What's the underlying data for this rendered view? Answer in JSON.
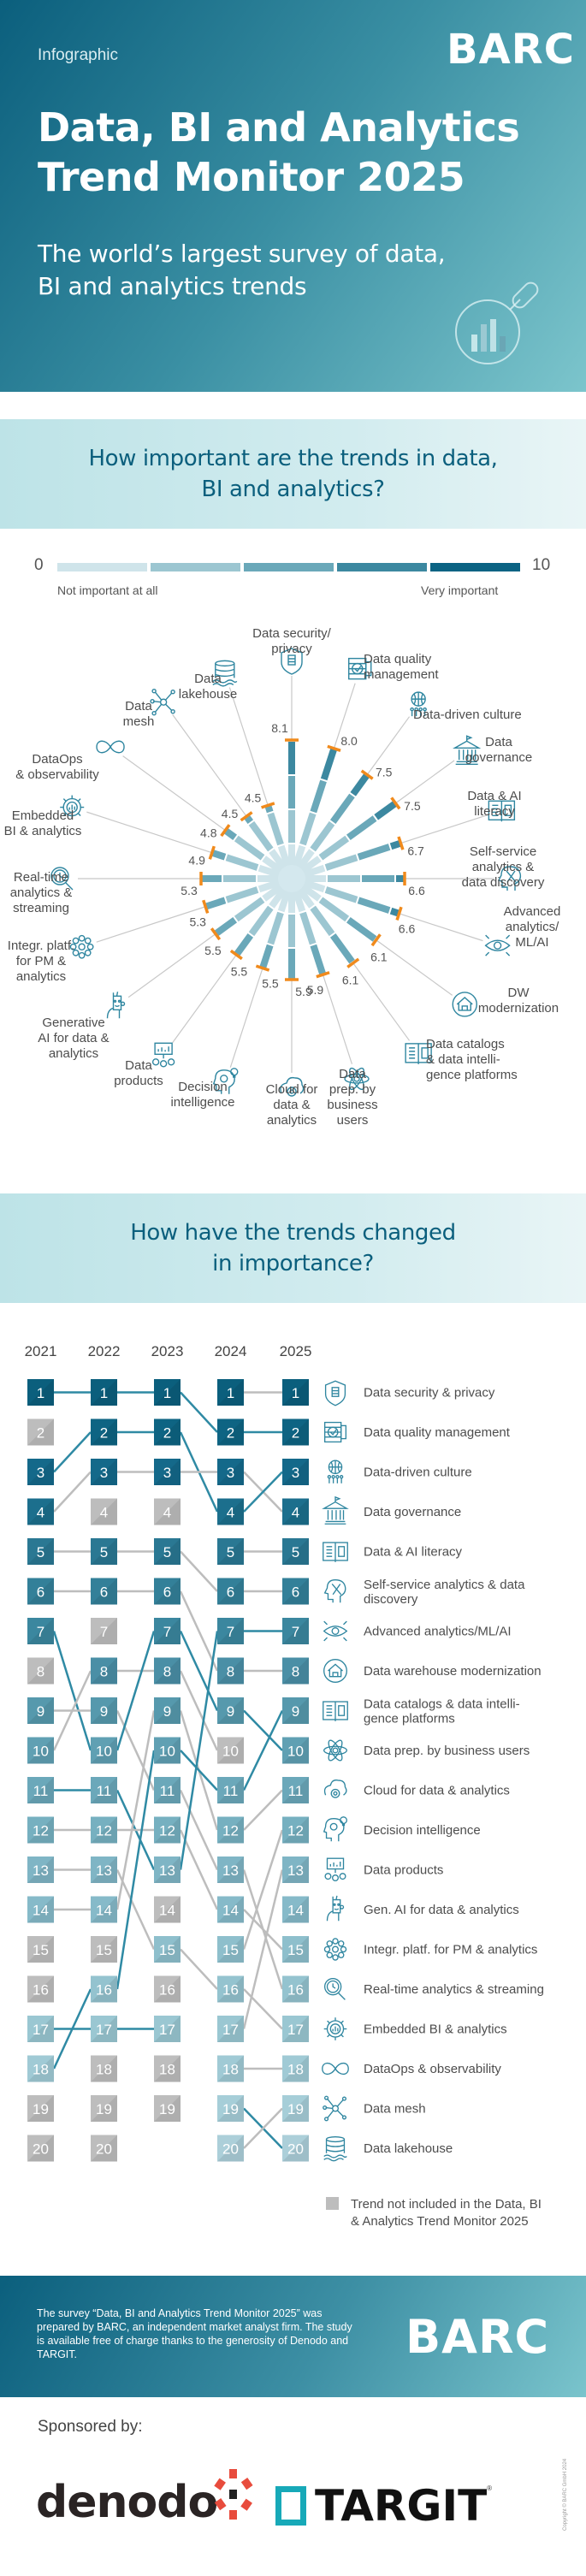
{
  "hero": {
    "kicker": "Infographic",
    "logo": "BARC",
    "title_line1": "Data, BI and Analytics",
    "title_line2": "Trend Monitor 2025",
    "subtitle_line1": "The world’s largest survey of data,",
    "subtitle_line2": "BI and analytics trends",
    "icon": "magnifier-chart-icon"
  },
  "section1": {
    "title_line1": "How important are the trends in data,",
    "title_line2": "BI and analytics?",
    "scale": {
      "min": "0",
      "max": "10",
      "min_label": "Not important at all",
      "max_label": "Very important",
      "colors": [
        "#cfe4ea",
        "#9cc6d1",
        "#6aa8b9",
        "#3c88a0",
        "#0b6383"
      ]
    }
  },
  "section2": {
    "title_line1": "How have the trends changed",
    "title_line2": "in importance?",
    "legend_note_line1": "Trend not included in the Data, BI",
    "legend_note_line2": "& Analytics Trend Monitor 2025"
  },
  "colors": {
    "brand_dark": "#0b5f7d",
    "accent_orange": "#f08a1c",
    "not_included_gray": "#bdbdbd",
    "line_blue": "#2f8aa4",
    "line_gray": "#bdbdbd"
  },
  "chart_data": [
    {
      "type": "radial-bar",
      "title": "How important are the trends in data, BI and analytics?",
      "scale_range": [
        0,
        10
      ],
      "categories": [
        {
          "label": "Data security/ privacy",
          "lines": [
            "Data security/",
            "privacy"
          ],
          "value": 8.1,
          "icon": "shield-database-icon"
        },
        {
          "label": "Data quality management",
          "lines": [
            "Data quality",
            "management"
          ],
          "value": 8.0,
          "icon": "database-check-icon"
        },
        {
          "label": "Data-driven culture",
          "lines": [
            "Data-driven culture"
          ],
          "value": 7.5,
          "icon": "globe-people-icon"
        },
        {
          "label": "Data governance",
          "lines": [
            "Data",
            "governance"
          ],
          "value": 7.5,
          "icon": "institution-icon"
        },
        {
          "label": "Data & AI literacy",
          "lines": [
            "Data & AI",
            "literacy"
          ],
          "value": 6.7,
          "icon": "book-database-icon"
        },
        {
          "label": "Self-service analytics & data discovery",
          "lines": [
            "Self-service",
            "analytics &",
            "data discovery"
          ],
          "value": 6.6,
          "icon": "head-tools-icon"
        },
        {
          "label": "Advanced analytics/ ML/AI",
          "lines": [
            "Advanced",
            "analytics/",
            "ML/AI"
          ],
          "value": 6.6,
          "icon": "eye-wrench-icon"
        },
        {
          "label": "DW modernization",
          "lines": [
            "DW",
            "modernization"
          ],
          "value": 6.1,
          "icon": "warehouse-cycle-icon"
        },
        {
          "label": "Data catalogs & data intelligence platforms",
          "lines": [
            "Data catalogs",
            "& data intelli-",
            "gence platforms"
          ],
          "value": 6.1,
          "icon": "book-open-icon"
        },
        {
          "label": "Data prep. by business users",
          "lines": [
            "Data",
            "prep. by",
            "business",
            "users"
          ],
          "value": 5.9,
          "icon": "atom-icon"
        },
        {
          "label": "Cloud for data & analytics",
          "lines": [
            "Cloud for",
            "data &",
            "analytics"
          ],
          "value": 5.9,
          "icon": "cloud-gear-icon"
        },
        {
          "label": "Decision intelligence",
          "lines": [
            "Decision",
            "intelligence"
          ],
          "value": 5.5,
          "icon": "head-gear-bulb-icon"
        },
        {
          "label": "Data products",
          "lines": [
            "Data",
            "products"
          ],
          "value": 5.5,
          "icon": "monitor-cubes-icon"
        },
        {
          "label": "Generative AI for data & analytics",
          "lines": [
            "Generative",
            "AI for data &",
            "analytics"
          ],
          "value": 5.5,
          "icon": "robot-face-icon"
        },
        {
          "label": "Integr. platf. for PM & analytics",
          "lines": [
            "Integr. platf.",
            "for PM &",
            "analytics"
          ],
          "value": 5.3,
          "icon": "hub-nodes-icon"
        },
        {
          "label": "Real-time analytics & streaming",
          "lines": [
            "Real-time",
            "analytics &",
            "streaming"
          ],
          "value": 5.3,
          "icon": "magnifier-clock-icon"
        },
        {
          "label": "Embedded BI & analytics",
          "lines": [
            "Embedded",
            "BI & analytics"
          ],
          "value": 4.9,
          "icon": "gear-chart-icon"
        },
        {
          "label": "DataOps & observability",
          "lines": [
            "DataOps",
            "& observability"
          ],
          "value": 4.8,
          "icon": "infinity-icon"
        },
        {
          "label": "Data mesh",
          "lines": [
            "Data",
            "mesh"
          ],
          "value": 4.5,
          "icon": "mesh-nodes-icon"
        },
        {
          "label": "Data lakehouse",
          "lines": [
            "Data",
            "lakehouse"
          ],
          "value": 4.5,
          "icon": "lakehouse-icon"
        }
      ]
    },
    {
      "type": "rank-slope",
      "title": "How have the trends changed in importance?",
      "years": [
        "2021",
        "2022",
        "2023",
        "2024",
        "2025"
      ],
      "ranks": [
        "1",
        "2",
        "3",
        "4",
        "5",
        "6",
        "7",
        "8",
        "9",
        "10",
        "11",
        "12",
        "13",
        "14",
        "15",
        "16",
        "17",
        "18",
        "19",
        "20"
      ],
      "max_rank_per_year": [
        20,
        20,
        19,
        20,
        20
      ],
      "not_included": {
        "2021": [
          2,
          8,
          15,
          16,
          19,
          20
        ],
        "2022": [
          4,
          7,
          15,
          18,
          19,
          20
        ],
        "2023": [
          4,
          14,
          16,
          18,
          19
        ],
        "2024": [
          10
        ],
        "2025": []
      },
      "links": [
        {
          "from_year": 0,
          "from": 1,
          "to": 1,
          "color": "blue"
        },
        {
          "from_year": 0,
          "from": 3,
          "to": 2,
          "color": "blue"
        },
        {
          "from_year": 0,
          "from": 4,
          "to": 3,
          "color": "gray"
        },
        {
          "from_year": 0,
          "from": 5,
          "to": 5,
          "color": "gray"
        },
        {
          "from_year": 0,
          "from": 6,
          "to": 6,
          "color": "gray"
        },
        {
          "from_year": 0,
          "from": 7,
          "to": 10,
          "color": "blue"
        },
        {
          "from_year": 0,
          "from": 9,
          "to": 9,
          "color": "gray"
        },
        {
          "from_year": 0,
          "from": 10,
          "to": 8,
          "color": "gray"
        },
        {
          "from_year": 0,
          "from": 11,
          "to": 11,
          "color": "blue"
        },
        {
          "from_year": 0,
          "from": 12,
          "to": 12,
          "color": "gray"
        },
        {
          "from_year": 0,
          "from": 13,
          "to": 13,
          "color": "gray"
        },
        {
          "from_year": 0,
          "from": 14,
          "to": 14,
          "color": "gray"
        },
        {
          "from_year": 0,
          "from": 17,
          "to": 17,
          "color": "blue"
        },
        {
          "from_year": 0,
          "from": 18,
          "to": 16,
          "color": "blue"
        },
        {
          "from_year": 1,
          "from": 1,
          "to": 1,
          "color": "blue"
        },
        {
          "from_year": 1,
          "from": 2,
          "to": 2,
          "color": "blue"
        },
        {
          "from_year": 1,
          "from": 3,
          "to": 3,
          "color": "gray"
        },
        {
          "from_year": 1,
          "from": 5,
          "to": 5,
          "color": "gray"
        },
        {
          "from_year": 1,
          "from": 6,
          "to": 6,
          "color": "gray"
        },
        {
          "from_year": 1,
          "from": 8,
          "to": 8,
          "color": "gray"
        },
        {
          "from_year": 1,
          "from": 9,
          "to": 11,
          "color": "gray"
        },
        {
          "from_year": 1,
          "from": 10,
          "to": 7,
          "color": "blue"
        },
        {
          "from_year": 1,
          "from": 11,
          "to": 13,
          "color": "blue"
        },
        {
          "from_year": 1,
          "from": 12,
          "to": 12,
          "color": "gray"
        },
        {
          "from_year": 1,
          "from": 13,
          "to": 15,
          "color": "gray"
        },
        {
          "from_year": 1,
          "from": 14,
          "to": 9,
          "color": "gray"
        },
        {
          "from_year": 1,
          "from": 16,
          "to": 10,
          "color": "blue"
        },
        {
          "from_year": 1,
          "from": 17,
          "to": 17,
          "color": "blue"
        },
        {
          "from_year": 2,
          "from": 1,
          "to": 2,
          "color": "blue"
        },
        {
          "from_year": 2,
          "from": 2,
          "to": 4,
          "color": "blue"
        },
        {
          "from_year": 2,
          "from": 3,
          "to": 3,
          "color": "gray"
        },
        {
          "from_year": 2,
          "from": 5,
          "to": 6,
          "color": "gray"
        },
        {
          "from_year": 2,
          "from": 6,
          "to": 8,
          "color": "gray"
        },
        {
          "from_year": 2,
          "from": 7,
          "to": 9,
          "color": "blue"
        },
        {
          "from_year": 2,
          "from": 8,
          "to": 10,
          "color": "gray"
        },
        {
          "from_year": 2,
          "from": 9,
          "to": 12,
          "color": "gray"
        },
        {
          "from_year": 2,
          "from": 10,
          "to": 11,
          "color": "blue"
        },
        {
          "from_year": 2,
          "from": 11,
          "to": 13,
          "color": "gray"
        },
        {
          "from_year": 2,
          "from": 12,
          "to": 14,
          "color": "gray"
        },
        {
          "from_year": 2,
          "from": 13,
          "to": 7,
          "color": "blue"
        },
        {
          "from_year": 2,
          "from": 15,
          "to": 16,
          "color": "gray"
        },
        {
          "from_year": 3,
          "from": 1,
          "to": 1,
          "color": "gray"
        },
        {
          "from_year": 3,
          "from": 2,
          "to": 2,
          "color": "blue"
        },
        {
          "from_year": 3,
          "from": 3,
          "to": 4,
          "color": "gray"
        },
        {
          "from_year": 3,
          "from": 4,
          "to": 3,
          "color": "blue"
        },
        {
          "from_year": 3,
          "from": 5,
          "to": 5,
          "color": "gray"
        },
        {
          "from_year": 3,
          "from": 6,
          "to": 6,
          "color": "gray"
        },
        {
          "from_year": 3,
          "from": 7,
          "to": 7,
          "color": "blue"
        },
        {
          "from_year": 3,
          "from": 8,
          "to": 8,
          "color": "gray"
        },
        {
          "from_year": 3,
          "from": 9,
          "to": 10,
          "color": "blue"
        },
        {
          "from_year": 3,
          "from": 11,
          "to": 9,
          "color": "blue"
        },
        {
          "from_year": 3,
          "from": 12,
          "to": 11,
          "color": "gray"
        },
        {
          "from_year": 3,
          "from": 13,
          "to": 16,
          "color": "gray"
        },
        {
          "from_year": 3,
          "from": 14,
          "to": 15,
          "color": "gray"
        },
        {
          "from_year": 3,
          "from": 15,
          "to": 12,
          "color": "gray"
        },
        {
          "from_year": 3,
          "from": 16,
          "to": 17,
          "color": "gray"
        },
        {
          "from_year": 3,
          "from": 17,
          "to": 13,
          "color": "gray"
        },
        {
          "from_year": 3,
          "from": 18,
          "to": 18,
          "color": "gray"
        },
        {
          "from_year": 3,
          "from": 19,
          "to": 20,
          "color": "blue"
        },
        {
          "from_year": 3,
          "from": 20,
          "to": 19,
          "color": "gray"
        }
      ],
      "legend_2025": [
        {
          "rank": 1,
          "label": "Data security & privacy",
          "icon": "shield-database-icon"
        },
        {
          "rank": 2,
          "label": "Data quality management",
          "icon": "database-check-icon"
        },
        {
          "rank": 3,
          "label": "Data-driven culture",
          "icon": "globe-people-icon"
        },
        {
          "rank": 4,
          "label": "Data governance",
          "icon": "institution-icon"
        },
        {
          "rank": 5,
          "label": "Data & AI literacy",
          "icon": "book-database-icon"
        },
        {
          "rank": 6,
          "label": "Self-service analytics & data discovery",
          "lines": [
            "Self-service analytics & data",
            "discovery"
          ],
          "icon": "head-tools-icon"
        },
        {
          "rank": 7,
          "label": "Advanced analytics/ML/AI",
          "icon": "eye-wrench-icon"
        },
        {
          "rank": 8,
          "label": "Data warehouse modernization",
          "icon": "warehouse-cycle-icon"
        },
        {
          "rank": 9,
          "label": "Data catalogs & data intelligence platforms",
          "lines": [
            "Data catalogs & data intelli-",
            "gence platforms"
          ],
          "icon": "book-open-icon"
        },
        {
          "rank": 10,
          "label": "Data prep. by business users",
          "icon": "atom-icon"
        },
        {
          "rank": 11,
          "label": "Cloud for data & analytics",
          "icon": "cloud-gear-icon"
        },
        {
          "rank": 12,
          "label": "Decision intelligence",
          "icon": "head-gear-bulb-icon"
        },
        {
          "rank": 13,
          "label": "Data products",
          "icon": "monitor-cubes-icon"
        },
        {
          "rank": 14,
          "label": "Gen. AI for data & analytics",
          "icon": "robot-face-icon"
        },
        {
          "rank": 15,
          "label": "Integr. platf. for PM & analytics",
          "icon": "hub-nodes-icon"
        },
        {
          "rank": 16,
          "label": "Real-time analytics & streaming",
          "icon": "magnifier-clock-icon"
        },
        {
          "rank": 17,
          "label": "Embedded BI & analytics",
          "icon": "gear-chart-icon"
        },
        {
          "rank": 18,
          "label": "DataOps & observability",
          "icon": "infinity-icon"
        },
        {
          "rank": 19,
          "label": "Data mesh",
          "icon": "mesh-nodes-icon"
        },
        {
          "rank": 20,
          "label": "Data lakehouse",
          "icon": "lakehouse-icon"
        }
      ]
    }
  ],
  "footer": {
    "text": "The survey “Data, BI and Analytics Trend Monitor 2025” was prepared by BARC, an independent market analyst firm. The study is available free of charge thanks to the generosity of Denodo and TARGIT.",
    "logo": "BARC"
  },
  "sponsors": {
    "label": "Sponsored by:",
    "names": [
      "denodo",
      "TARGIT"
    ],
    "registered": "®",
    "copyright": "Copyright © BARC GmbH 2024"
  }
}
